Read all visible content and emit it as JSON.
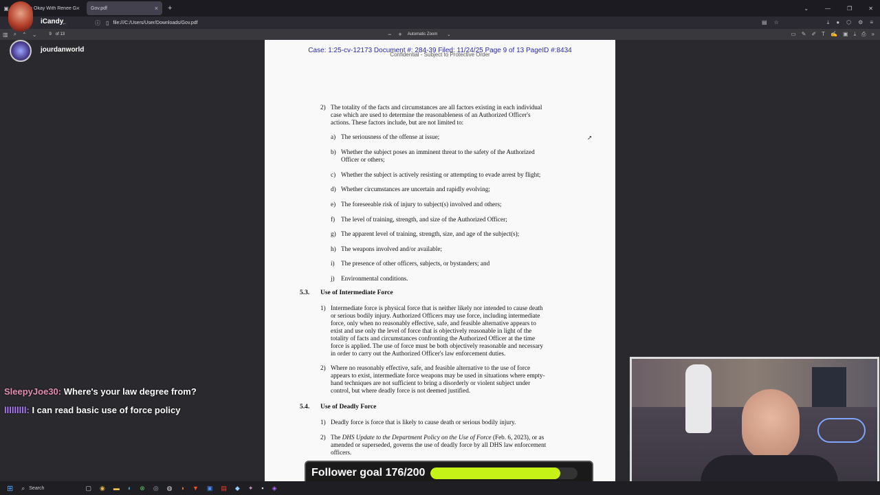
{
  "browser": {
    "tabs": [
      {
        "label": "ICE Is Okay With Renee Good's ...",
        "active": false
      },
      {
        "label": "Gov.pdf",
        "active": true
      }
    ],
    "new_tab": "+",
    "url": "file:///C:/Users/User/Downloads/Gov.pdf"
  },
  "pdf_toolbar": {
    "page_num": "9",
    "page_total": "of 13",
    "zoom_minus": "−",
    "zoom_plus": "+",
    "zoom": "Automatic Zoom"
  },
  "overlay": {
    "brand": "iCandy",
    "channel": "jourdanworld"
  },
  "document": {
    "header": "Case: 1:25-cv-12173 Document #: 284-39 Filed: 11/24/25 Page 9 of 13 PageID #:8434",
    "confidential": "Confidential - Subject to Protective Order",
    "item2_num": "2)",
    "item2_lines": [
      "The totality of the facts and circumstances are all factors existing in each individual",
      "case which are used to determine the reasonableness of an Authorized Officer's",
      "actions. These factors include, but are not limited to:"
    ],
    "factors": [
      {
        "letter": "a)",
        "lines": [
          "The seriousness of the offense at issue;"
        ]
      },
      {
        "letter": "b)",
        "lines": [
          "Whether the subject poses an imminent threat to the safety of the Authorized",
          "Officer or others;"
        ]
      },
      {
        "letter": "c)",
        "lines": [
          "Whether the subject is actively resisting or attempting to evade arrest by flight;"
        ]
      },
      {
        "letter": "d)",
        "lines": [
          "Whether circumstances are uncertain and rapidly evolving;"
        ]
      },
      {
        "letter": "e)",
        "lines": [
          "The foreseeable risk of injury to subject(s) involved and others;"
        ]
      },
      {
        "letter": "f)",
        "lines": [
          "The level of training, strength, and size of the Authorized Officer;"
        ]
      },
      {
        "letter": "g)",
        "lines": [
          "The apparent level of training, strength, size, and age of the subject(s);"
        ]
      },
      {
        "letter": "h)",
        "lines": [
          "The weapons involved and/or available;"
        ]
      },
      {
        "letter": "i)",
        "lines": [
          "The presence of other officers, subjects, or bystanders; and"
        ]
      },
      {
        "letter": "j)",
        "lines": [
          "Environmental conditions."
        ]
      }
    ],
    "sec53_num": "5.3.",
    "sec53_title": "Use of Intermediate Force",
    "sec53_items": [
      {
        "num": "1)",
        "lines": [
          "Intermediate force is physical force that is neither likely nor intended to cause death",
          "or serious bodily injury. Authorized Officers may use force, including intermediate",
          "force, only when no reasonably effective, safe, and feasible alternative appears to",
          "exist and use only the level of force that is objectively reasonable in light of the",
          "totality of facts and circumstances confronting the Authorized Officer at the time",
          "force is applied.  The use of force must be both objectively reasonable and necessary",
          "in order to carry out the Authorized Officer's law enforcement duties."
        ]
      },
      {
        "num": "2)",
        "lines": [
          "Where no reasonably effective, safe, and feasible alternative to the use of force",
          "appears to exist, intermediate force weapons may be used in situations where empty-",
          "hand techniques are not sufficient to bring a disorderly or violent subject under",
          "control, but where deadly force is not deemed justified."
        ]
      }
    ],
    "sec54_num": "5.4.",
    "sec54_title": "Use of Deadly Force",
    "sec54_item1_num": "1)",
    "sec54_item1": "Deadly force is force that is likely to cause death or serious bodily injury.",
    "sec54_item2_num": "2)",
    "sec54_item2_pre": "The ",
    "sec54_item2_italic": "DHS Update to the Department Policy on the Use of Force",
    "sec54_item2_post": " (Feb. 6, 2023), or as",
    "sec54_item2_lines": [
      "amended or superseded, governs the use of deadly force by all DHS law enforcement",
      "officers."
    ]
  },
  "chat": [
    {
      "user": "SleepyJoe30:",
      "user_color": "#e58fb3",
      "message": " Where's your law degree from?"
    },
    {
      "user": "lllllllll:",
      "user_color": "#b27cff",
      "message": " I can read basic use of force policy"
    }
  ],
  "follower_goal": {
    "label": "Follower goal 176/200",
    "current": 176,
    "target": 200,
    "fill_color": "#c6f317"
  },
  "taskbar": {
    "search": "Search"
  }
}
